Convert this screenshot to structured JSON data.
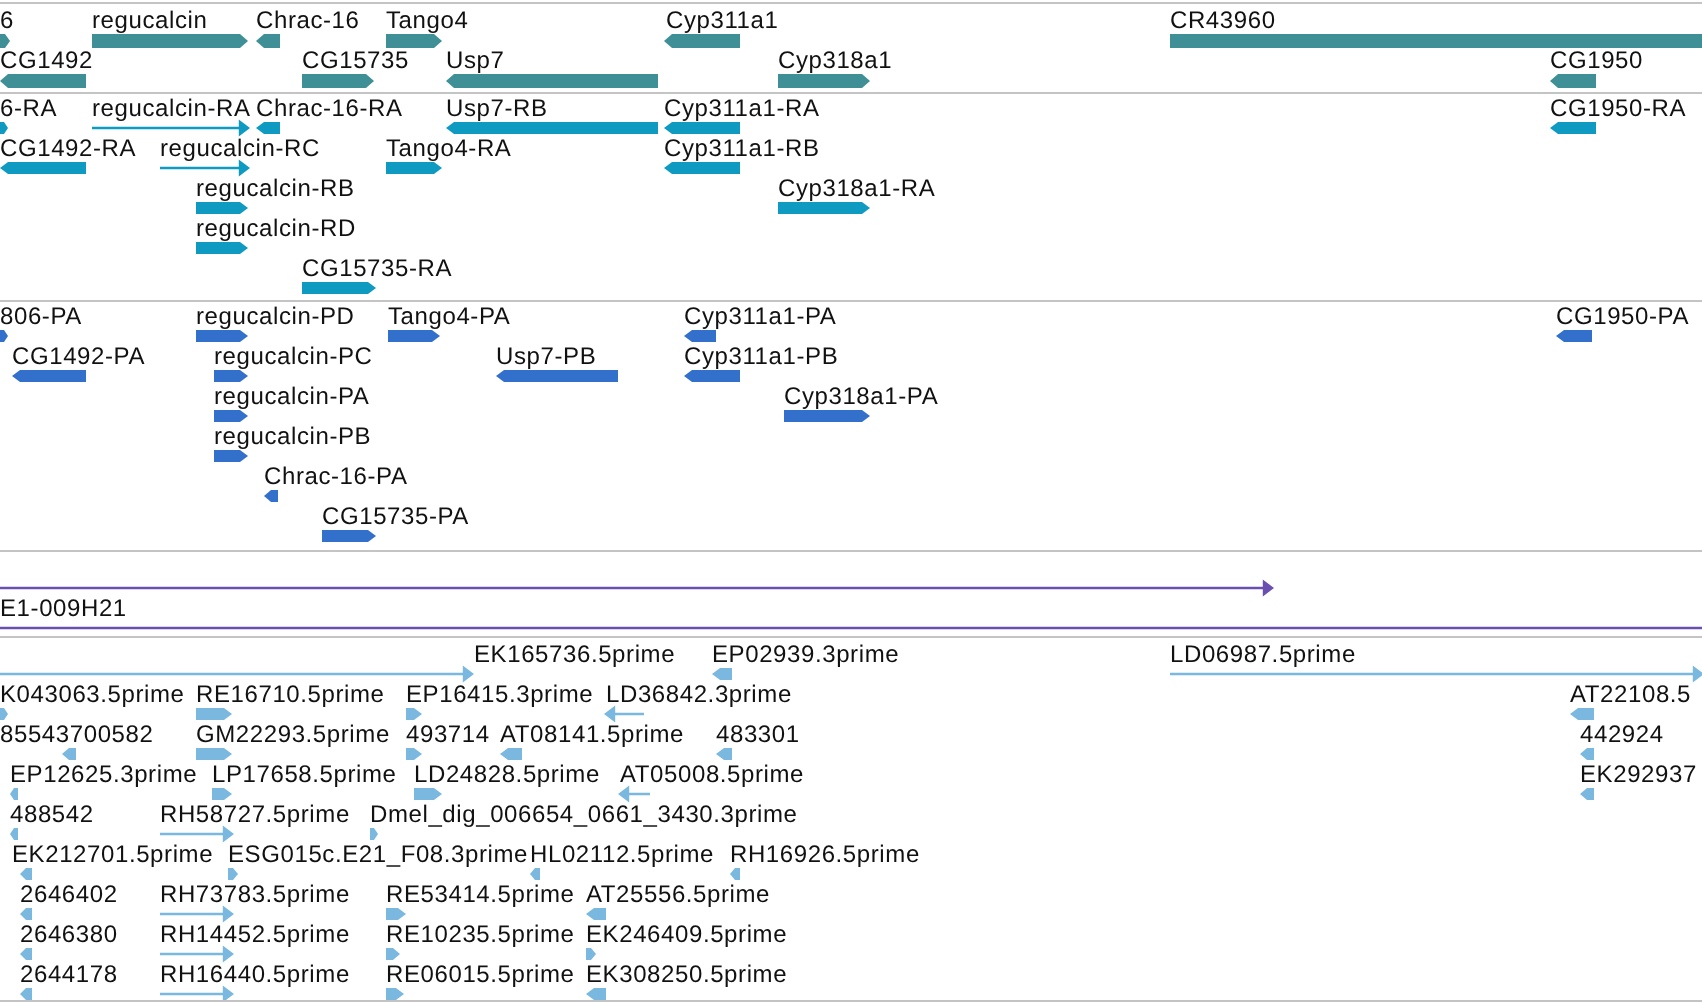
{
  "tracks": [
    {
      "kind": "gene",
      "features": [
        {
          "label": "6",
          "forward": true,
          "reverse": false
        },
        {
          "label": "regucalcin",
          "forward": true,
          "reverse": false
        },
        {
          "label": "Chrac-16",
          "forward": false,
          "reverse": true
        },
        {
          "label": "Tango4",
          "forward": true,
          "reverse": false
        },
        {
          "label": "Cyp311a1",
          "forward": false,
          "reverse": true
        },
        {
          "label": "CR43960",
          "forward": false,
          "reverse": false
        },
        {
          "label": "CG1492",
          "forward": false,
          "reverse": true
        },
        {
          "label": "CG15735",
          "forward": true,
          "reverse": false
        },
        {
          "label": "Usp7",
          "forward": false,
          "reverse": true
        },
        {
          "label": "Cyp318a1",
          "forward": true,
          "reverse": false
        },
        {
          "label": "CG1950",
          "forward": false,
          "reverse": true
        }
      ]
    },
    {
      "kind": "mrna",
      "features": [
        {
          "label": "6-RA",
          "forward": true,
          "reverse": false
        },
        {
          "label": "regucalcin-RA",
          "forward": true,
          "reverse": false
        },
        {
          "label": "Chrac-16-RA",
          "forward": false,
          "reverse": true
        },
        {
          "label": "Usp7-RB",
          "forward": false,
          "reverse": true
        },
        {
          "label": "Cyp311a1-RA",
          "forward": false,
          "reverse": true
        },
        {
          "label": "CG1950-RA",
          "forward": false,
          "reverse": true
        },
        {
          "label": "CG1492-RA",
          "forward": false,
          "reverse": true
        },
        {
          "label": "regucalcin-RC",
          "forward": true,
          "reverse": false
        },
        {
          "label": "Tango4-RA",
          "forward": true,
          "reverse": false
        },
        {
          "label": "Cyp311a1-RB",
          "forward": false,
          "reverse": true
        },
        {
          "label": "regucalcin-RB",
          "forward": true,
          "reverse": false
        },
        {
          "label": "Cyp318a1-RA",
          "forward": true,
          "reverse": false
        },
        {
          "label": "regucalcin-RD",
          "forward": true,
          "reverse": false
        },
        {
          "label": "CG15735-RA",
          "forward": true,
          "reverse": false
        }
      ]
    },
    {
      "kind": "polypeptide",
      "features": [
        {
          "label": "806-PA",
          "forward": true,
          "reverse": false
        },
        {
          "label": "regucalcin-PD",
          "forward": true,
          "reverse": false
        },
        {
          "label": "Tango4-PA",
          "forward": true,
          "reverse": false
        },
        {
          "label": "Cyp311a1-PA",
          "forward": false,
          "reverse": true
        },
        {
          "label": "CG1950-PA",
          "forward": false,
          "reverse": true
        },
        {
          "label": "CG1492-PA",
          "forward": false,
          "reverse": true
        },
        {
          "label": "regucalcin-PC",
          "forward": true,
          "reverse": false
        },
        {
          "label": "Usp7-PB",
          "forward": false,
          "reverse": true
        },
        {
          "label": "Cyp311a1-PB",
          "forward": false,
          "reverse": true
        },
        {
          "label": "regucalcin-PA",
          "forward": true,
          "reverse": false
        },
        {
          "label": "Cyp318a1-PA",
          "forward": true,
          "reverse": false
        },
        {
          "label": "regucalcin-PB",
          "forward": true,
          "reverse": false
        },
        {
          "label": "Chrac-16-PA",
          "forward": false,
          "reverse": true
        },
        {
          "label": "CG15735-PA",
          "forward": true,
          "reverse": false
        }
      ]
    },
    {
      "kind": "clone",
      "features": [
        {
          "forward": true,
          "reverse": false
        },
        {
          "label": "E1-009H21",
          "forward": false,
          "reverse": false
        }
      ]
    },
    {
      "kind": "est",
      "features": [
        {
          "label": "EK165736.5prime",
          "forward": true,
          "reverse": false
        },
        {
          "label": "EP02939.3prime",
          "forward": false,
          "reverse": true
        },
        {
          "label": "LD06987.5prime",
          "forward": true,
          "reverse": false
        },
        {
          "label": "K043063.5prime",
          "forward": true,
          "reverse": false
        },
        {
          "label": "RE16710.5prime",
          "forward": true,
          "reverse": false
        },
        {
          "label": "EP16415.3prime",
          "forward": true,
          "reverse": false
        },
        {
          "label": "LD36842.3prime",
          "forward": false,
          "reverse": true
        },
        {
          "label": "AT22108.5",
          "forward": false,
          "reverse": true
        },
        {
          "label": "85543700582",
          "forward": false,
          "reverse": true
        },
        {
          "label": "GM22293.5prime",
          "forward": true,
          "reverse": false
        },
        {
          "label": "493714",
          "forward": true,
          "reverse": false
        },
        {
          "label": "AT08141.5prime",
          "forward": false,
          "reverse": true
        },
        {
          "label": "483301",
          "forward": false,
          "reverse": true
        },
        {
          "label": "442924",
          "forward": false,
          "reverse": true
        },
        {
          "label": "EP12625.3prime",
          "forward": false,
          "reverse": true
        },
        {
          "label": "LP17658.5prime",
          "forward": true,
          "reverse": false
        },
        {
          "label": "LD24828.5prime",
          "forward": true,
          "reverse": false
        },
        {
          "label": "AT05008.5prime",
          "forward": false,
          "reverse": true
        },
        {
          "label": "EK292937",
          "forward": false,
          "reverse": true
        },
        {
          "label": "488542",
          "forward": false,
          "reverse": true
        },
        {
          "label": "RH58727.5prime",
          "forward": true,
          "reverse": false
        },
        {
          "label": "Dmel_dig_006654_0661_3430.3prime",
          "forward": true,
          "reverse": false
        },
        {
          "label": "EK212701.5prime",
          "forward": false,
          "reverse": true
        },
        {
          "label": "ESG015c.E21_F08.3prime",
          "forward": true,
          "reverse": false
        },
        {
          "label": "HL02112.5prime",
          "forward": false,
          "reverse": true
        },
        {
          "label": "RH16926.5prime",
          "forward": false,
          "reverse": true
        },
        {
          "label": "2646402",
          "forward": false,
          "reverse": true
        },
        {
          "label": "RH73783.5prime",
          "forward": true,
          "reverse": false
        },
        {
          "label": "RE53414.5prime",
          "forward": true,
          "reverse": false
        },
        {
          "label": "AT25556.5prime",
          "forward": false,
          "reverse": true
        },
        {
          "label": "2646380",
          "forward": false,
          "reverse": true
        },
        {
          "label": "RH14452.5prime",
          "forward": true,
          "reverse": false
        },
        {
          "label": "RE10235.5prime",
          "forward": true,
          "reverse": false
        },
        {
          "label": "EK246409.5prime",
          "forward": true,
          "reverse": false
        },
        {
          "label": "2644178",
          "forward": false,
          "reverse": true
        },
        {
          "label": "RH16440.5prime",
          "forward": true,
          "reverse": false
        },
        {
          "label": "RE06015.5prime",
          "forward": true,
          "reverse": false
        },
        {
          "label": "EK308250.5prime",
          "forward": false,
          "reverse": true
        }
      ]
    }
  ]
}
